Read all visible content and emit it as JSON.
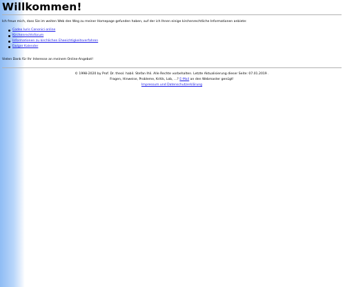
{
  "page": {
    "title": "Willkommen!",
    "intro": "Ich freue mich, dass Sie im weiten Web den Weg zu meiner Homepage gefunden haben, auf der ich Ihnen einige kirchenrechtliche Informationen anbiete:",
    "links": [
      {
        "label": "Codex Iuris Canonici online"
      },
      {
        "label": "Kirchenrechtsforum"
      },
      {
        "label": "Informationen zu kirchlichen Eheeichtigkeitsverfahren"
      },
      {
        "label": "Ewiger Kalender"
      }
    ],
    "thanks": "Vielen Dank für Ihr Interesse an meinem Online-Angebot!"
  },
  "footer": {
    "copyright": "© 1998-2020 by Prof. Dr. theol. habil. Stefan Ihli. Alle Rechte vorbehalten. Letzte Aktualisierung dieser Seite: 07.01.2019 .",
    "contact_prefix": "Fragen, Hinweise, Probleme, Kritik, Lob, ...?",
    "mail_link": "E-Mail",
    "contact_suffix": "an den Webmaster genügt!",
    "privacy_link": "Impressum und Datenschutzerklärung"
  },
  "colors": {
    "link": "#1a1ae6",
    "gradient_start": "#8fbcf4"
  }
}
